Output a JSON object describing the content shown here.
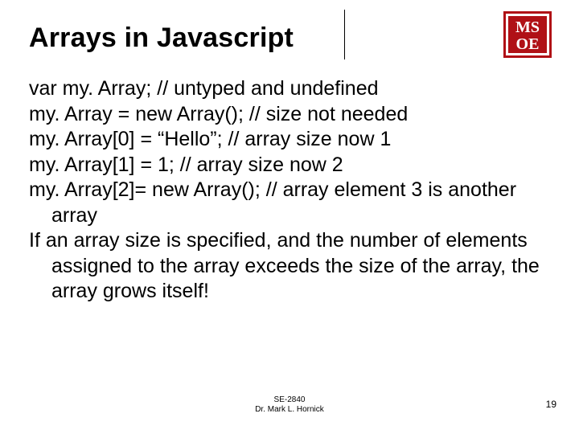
{
  "logo": {
    "top": "MS",
    "bottom": "OE"
  },
  "title": "Arrays in Javascript",
  "lines": [
    "var my. Array; // untyped and undefined",
    "my. Array = new Array(); // size not needed",
    "my. Array[0] = “Hello”; // array size now 1",
    "my. Array[1] = 1; // array size now 2",
    "my. Array[2]= new Array(); // array element 3 is another array",
    "If an array size is specified, and the number of elements assigned to the array exceeds the size of the array, the array grows itself!"
  ],
  "footer": {
    "course": "SE-2840",
    "author": "Dr. Mark L. Hornick"
  },
  "page": "19"
}
